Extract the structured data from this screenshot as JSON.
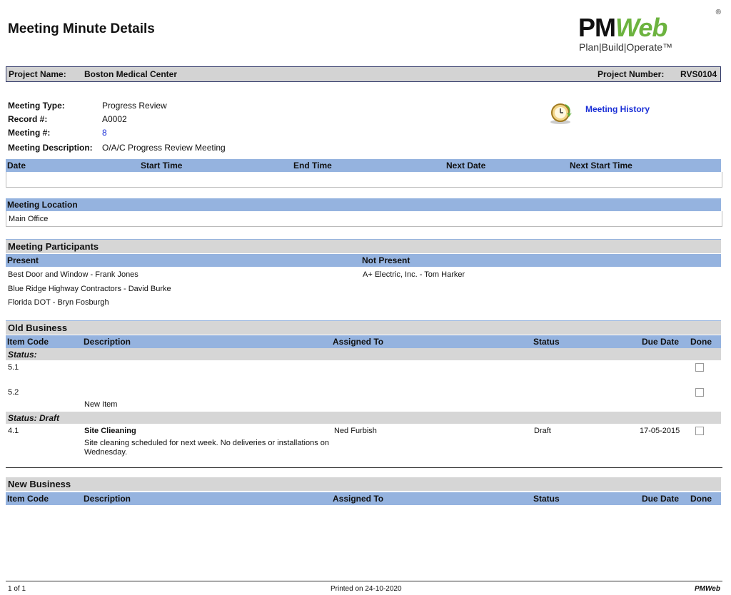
{
  "header": {
    "title": "Meeting Minute Details",
    "logo_text_a": "PM",
    "logo_text_b": "Web",
    "logo_reg": "®",
    "logo_tagline": "Plan|Build|Operate™"
  },
  "project": {
    "name_label": "Project Name:",
    "name": "Boston Medical Center",
    "number_label": "Project Number:",
    "number": "RVS0104"
  },
  "meeting": {
    "type_label": "Meeting Type:",
    "type": "Progress Review",
    "record_label": "Record #:",
    "record": "A0002",
    "number_label": "Meeting #:",
    "number": "8",
    "desc_label": "Meeting Description:",
    "desc": "O/A/C Progress Review Meeting",
    "history_link": "Meeting History",
    "history_icon": "clock-history-icon"
  },
  "schedule": {
    "columns": [
      "Date",
      "Start Time",
      "End Time",
      "Next Date",
      "Next Start Time"
    ]
  },
  "location": {
    "header": "Meeting Location",
    "value": "Main Office"
  },
  "participants": {
    "header": "Meeting Participants",
    "present_label": "Present",
    "not_present_label": "Not Present",
    "present": [
      "Best Door and Window - Frank Jones",
      "Blue Ridge Highway Contractors - David  Burke",
      "Florida DOT - Bryn Fosburgh"
    ],
    "not_present": [
      "A+ Electric, Inc. - Tom Harker"
    ]
  },
  "old_business": {
    "header": "Old Business",
    "columns": [
      "Item Code",
      "Description",
      "Assigned To",
      "Status",
      "Due Date",
      "Done"
    ],
    "group1_status": "Status:",
    "item_5_1": "5.1",
    "item_5_2": "5.2",
    "item_5_2_desc": "New Item",
    "group2_status": "Status:   Draft",
    "item_4_1": {
      "code": "4.1",
      "title": "Site Clieaning",
      "desc": "Site cleaning scheduled for next week.  No deliveries or installations on Wednesday.",
      "assigned": "Ned Furbish",
      "status": "Draft",
      "due": "17-05-2015"
    }
  },
  "new_business": {
    "header": "New Business",
    "columns": [
      "Item Code",
      "Description",
      "Assigned To",
      "Status",
      "Due Date",
      "Done"
    ]
  },
  "footer": {
    "page": "1 of 1",
    "printed": "Printed on 24-10-2020",
    "brand": "PMWeb"
  },
  "colors": {
    "header_blue": "#95b3df",
    "section_gray": "#d6d6d6",
    "link_blue": "#1a2fd6",
    "logo_green": "#6cb33f"
  }
}
